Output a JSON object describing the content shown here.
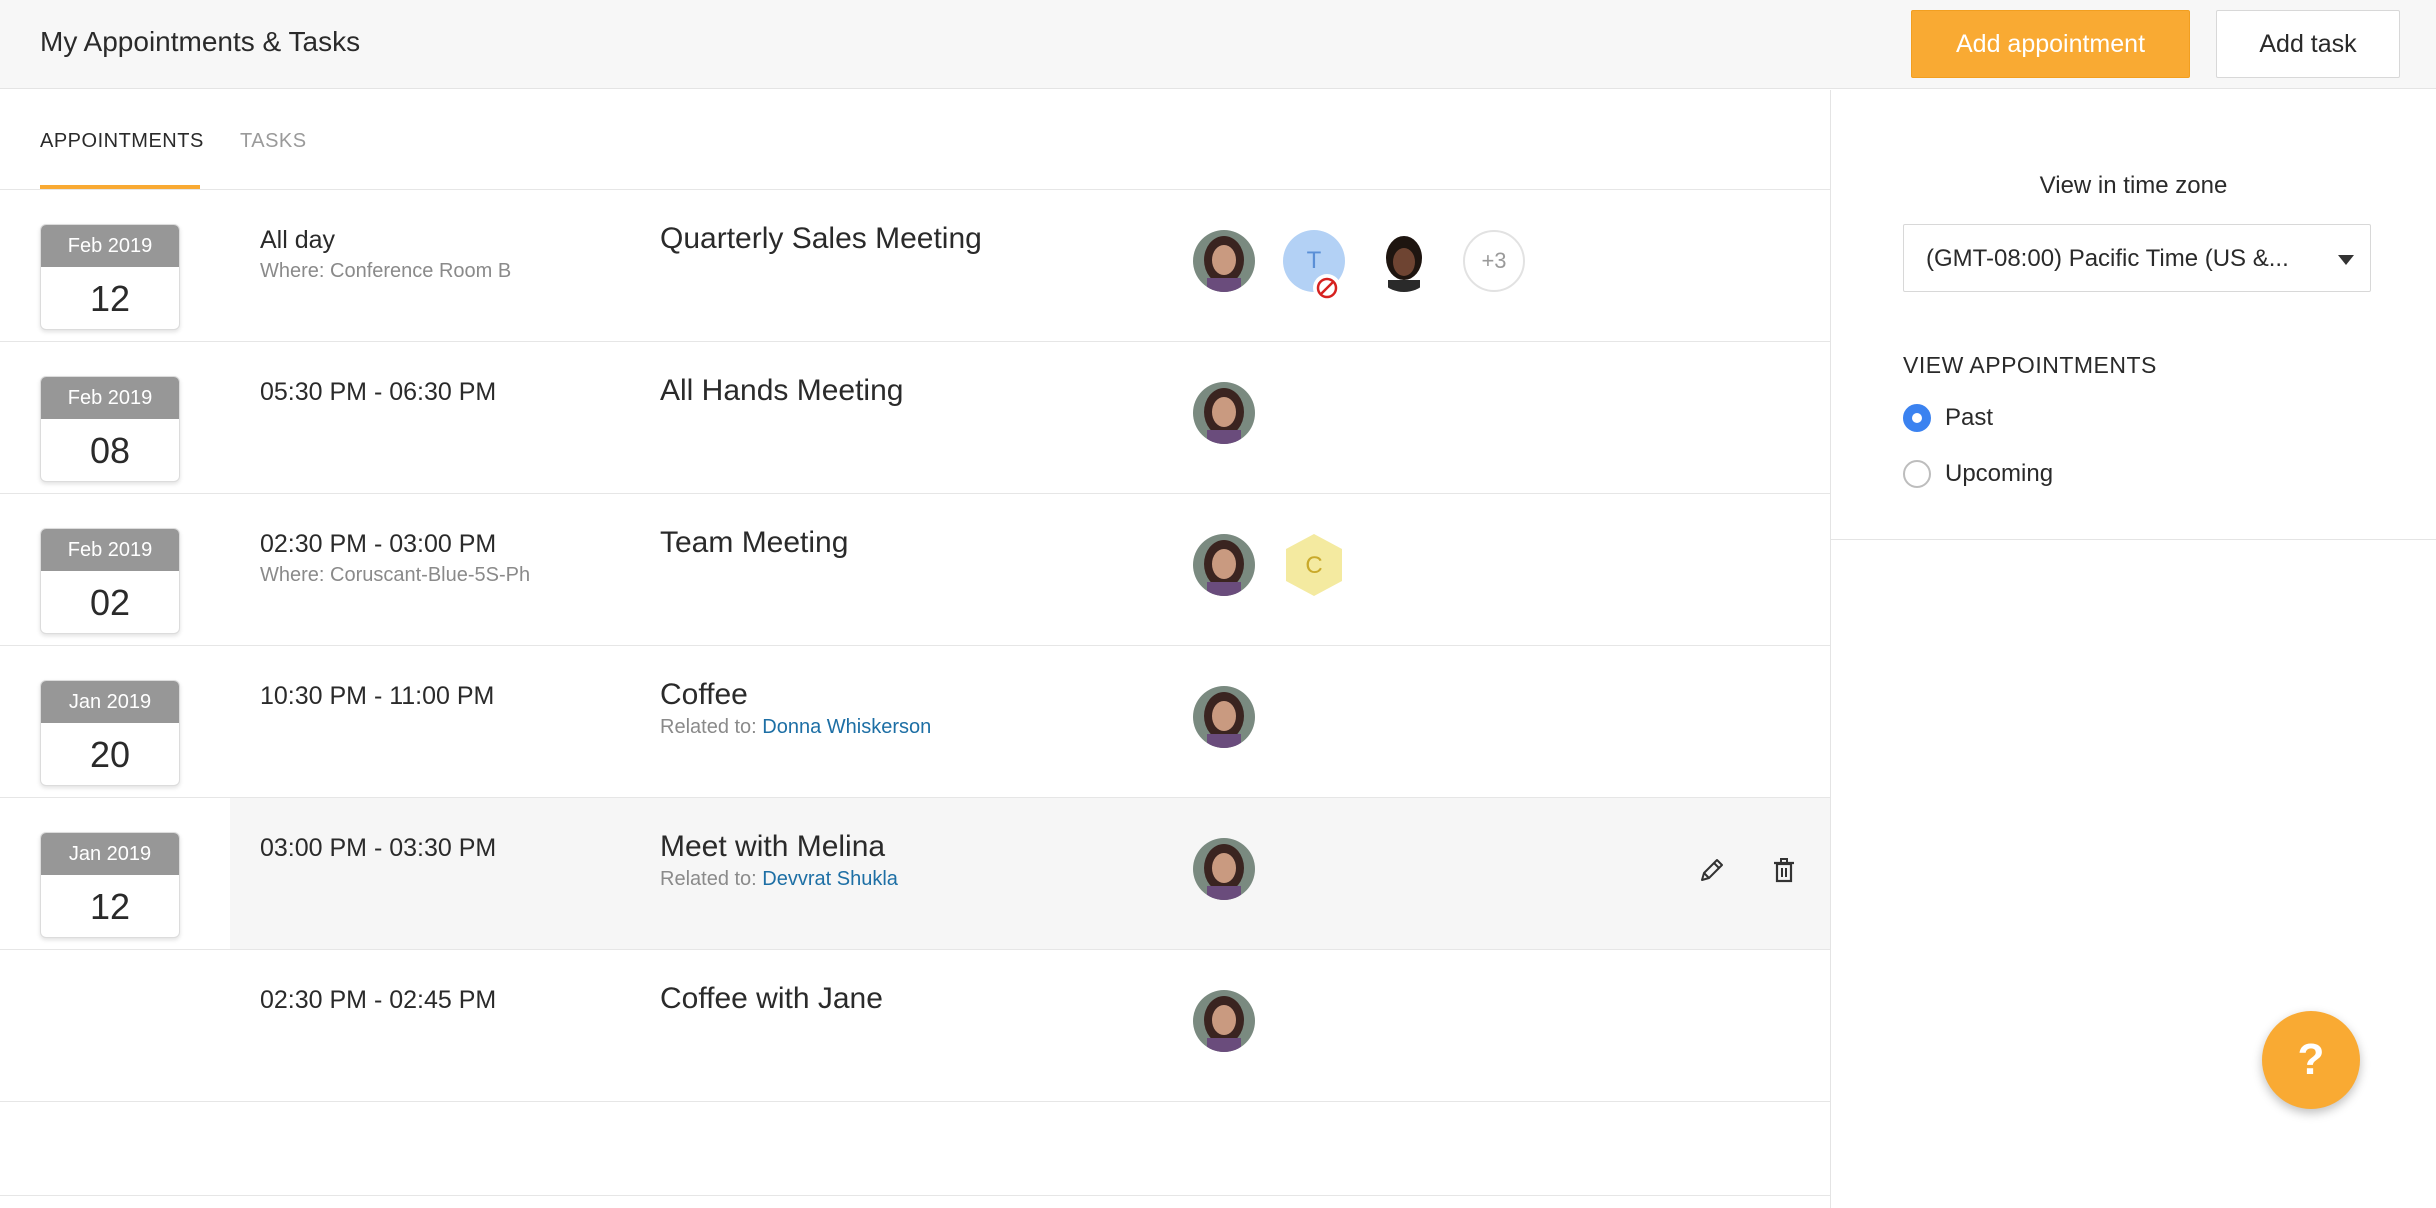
{
  "header": {
    "title": "My Appointments & Tasks",
    "add_appointment_label": "Add appointment",
    "add_task_label": "Add task"
  },
  "tabs": [
    {
      "label": "APPOINTMENTS",
      "active": true
    },
    {
      "label": "TASKS",
      "active": false
    }
  ],
  "appointments": [
    {
      "month": "Feb 2019",
      "day": "12",
      "time": "All day",
      "where": "Where: Conference Room B",
      "title": "Quarterly Sales Meeting",
      "more_count": "+3",
      "initial": "T"
    },
    {
      "month": "Feb 2019",
      "day": "08",
      "time": "05:30 PM - 06:30 PM",
      "title": "All Hands Meeting"
    },
    {
      "month": "Feb 2019",
      "day": "02",
      "time": "02:30 PM - 03:00 PM",
      "where": "Where: Coruscant-Blue-5S-Ph",
      "title": "Team Meeting",
      "initial": "C"
    },
    {
      "month": "Jan 2019",
      "day": "20",
      "time": "10:30 PM - 11:00 PM",
      "title": "Coffee",
      "related_prefix": "Related to: ",
      "related_name": "Donna Whiskerson"
    },
    {
      "month": "Jan 2019",
      "day": "12",
      "time": "03:00 PM - 03:30 PM",
      "title": "Meet with Melina",
      "related_prefix": "Related to: ",
      "related_name": "Devvrat Shukla"
    },
    {
      "time": "02:30 PM - 02:45 PM",
      "title": "Coffee with Jane"
    }
  ],
  "sidebar": {
    "timezone_label": "View in time zone",
    "timezone_value": "(GMT-08:00) Pacific Time (US &...",
    "view_heading": "VIEW APPOINTMENTS",
    "options": [
      {
        "label": "Past",
        "checked": true
      },
      {
        "label": "Upcoming",
        "checked": false
      }
    ]
  },
  "help_label": "?",
  "colors": {
    "accent": "#f9aa33",
    "link": "#1d6fa5",
    "radio": "#3b82f0"
  }
}
